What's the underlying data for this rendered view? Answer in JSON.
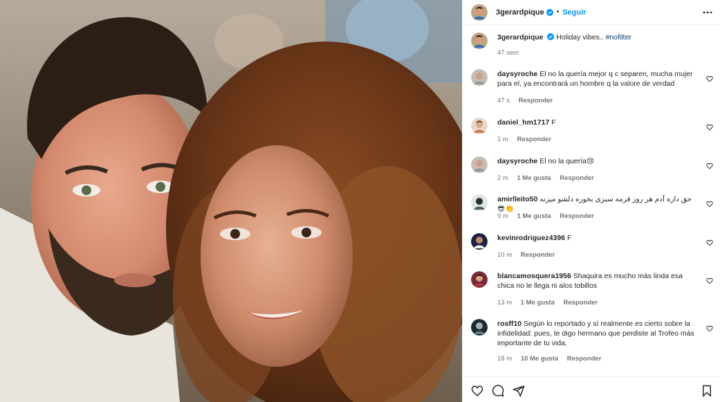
{
  "post": {
    "author": "3gerardpique",
    "follow_label": "Seguir",
    "separator": "•",
    "caption_text": "Holiday vibes..",
    "caption_hashtag": "#nofilter",
    "caption_time": "47 sem"
  },
  "comments": [
    {
      "user": "daysyroche",
      "text": "El no la quería mejor q c separen, mucha mujer para el, ya encontrará un hombre q la valore de verdad",
      "time": "47 s",
      "likes": "",
      "reply": "Responder"
    },
    {
      "user": "daniel_hm1717",
      "text": "F",
      "time": "1 m",
      "likes": "",
      "reply": "Responder"
    },
    {
      "user": "daysyroche",
      "text": "El no la quería😢",
      "time": "2 m",
      "likes": "1 Me gusta",
      "reply": "Responder"
    },
    {
      "user": "amirlleito50",
      "text": "حق داره آدم هر روز قرمه سبزی بخوره دلشو میزنه 😎👏",
      "time": "9 m",
      "likes": "1 Me gusta",
      "reply": "Responder"
    },
    {
      "user": "kevinrodriguez4396",
      "text": "F",
      "time": "10 m",
      "likes": "",
      "reply": "Responder"
    },
    {
      "user": "blancamosquera1956",
      "text": "Shaquira es mucho más linda esa chica no le llega ni alos tobillos",
      "time": "13 m",
      "likes": "1 Me gusta",
      "reply": "Responder"
    },
    {
      "user": "rosff10",
      "text": "Según lo reportado y sí realmente es cierto sobre la infidelidad: pues, te digo hermano que perdiste al Trofeo más importante de tu vida.",
      "time": "18 m",
      "likes": "10 Me gusta",
      "reply": "Responder"
    }
  ],
  "icons": {
    "more": "more-icon",
    "verified": "verified-badge-icon",
    "like": "heart-icon",
    "comment": "comment-icon",
    "share": "share-icon",
    "save": "bookmark-icon"
  },
  "colors": {
    "accent": "#0095f6",
    "verified": "#0095f6",
    "muted": "#737373",
    "text": "#262626",
    "hashtag": "#00376b"
  }
}
